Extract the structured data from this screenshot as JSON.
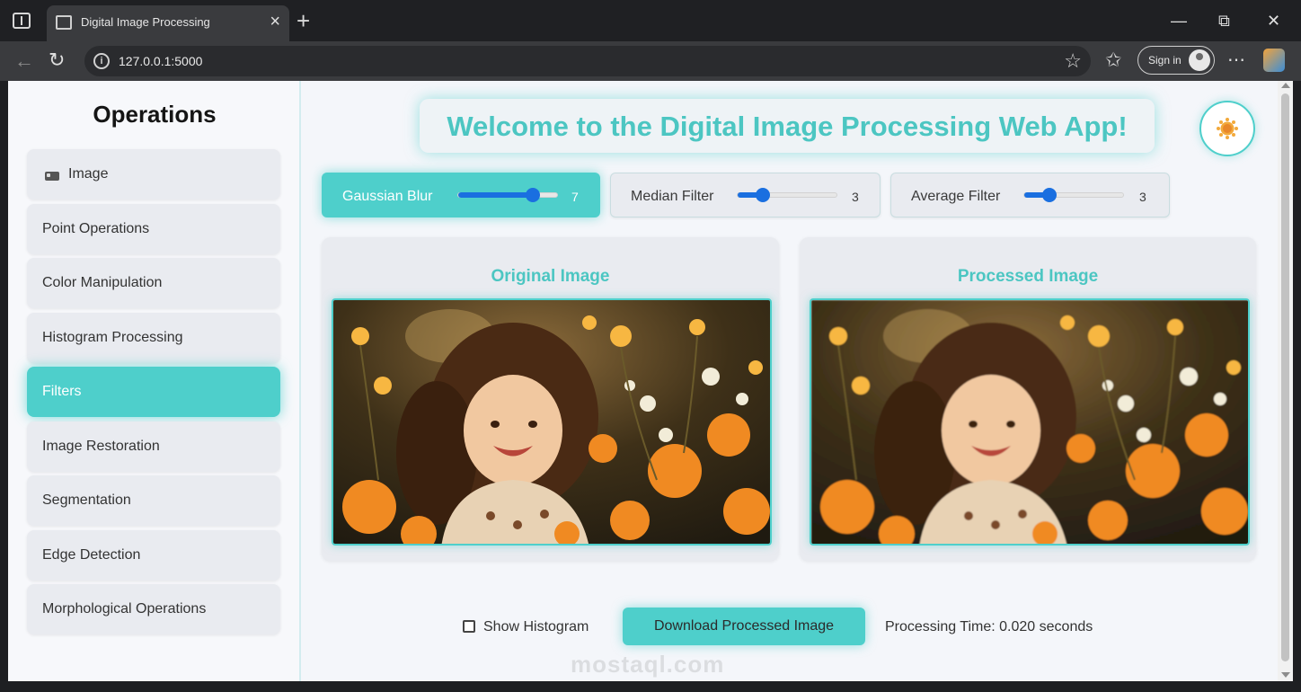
{
  "browser": {
    "tab_title": "Digital Image Processing",
    "new_tab_symbol": "+",
    "url": "127.0.0.1:5000",
    "sign_in_label": "Sign in",
    "more_symbol": "⋯",
    "window_controls": {
      "minimize": "—",
      "maximize": "⧉",
      "close": "✕"
    }
  },
  "sidebar": {
    "title": "Operations",
    "items": [
      {
        "label": "Image",
        "icon": "image-icon",
        "active": false
      },
      {
        "label": "Point Operations",
        "active": false
      },
      {
        "label": "Color Manipulation",
        "active": false
      },
      {
        "label": "Histogram Processing",
        "active": false
      },
      {
        "label": "Filters",
        "active": true
      },
      {
        "label": "Image Restoration",
        "active": false
      },
      {
        "label": "Segmentation",
        "active": false
      },
      {
        "label": "Edge Detection",
        "active": false
      },
      {
        "label": "Morphological Operations",
        "active": false
      }
    ]
  },
  "header": {
    "welcome": "Welcome to the Digital Image Processing Web App!",
    "theme_toggle_icon": "sun-icon"
  },
  "filters": [
    {
      "label": "Gaussian Blur",
      "value": "7",
      "level": 0.75,
      "active": true
    },
    {
      "label": "Median Filter",
      "value": "3",
      "level": 0.25,
      "active": false
    },
    {
      "label": "Average Filter",
      "value": "3",
      "level": 0.25,
      "active": false
    }
  ],
  "panels": {
    "original_title": "Original Image",
    "processed_title": "Processed Image"
  },
  "footer": {
    "show_histogram_label": "Show Histogram",
    "download_label": "Download Processed Image",
    "processing_time": "Processing Time: 0.020 seconds"
  },
  "watermark": "mostaql.com",
  "colors": {
    "accent": "#4ecfcb",
    "accent_text": "#4cc6c2",
    "slider": "#1a6fe0",
    "panel_bg": "#e9ebf0"
  }
}
